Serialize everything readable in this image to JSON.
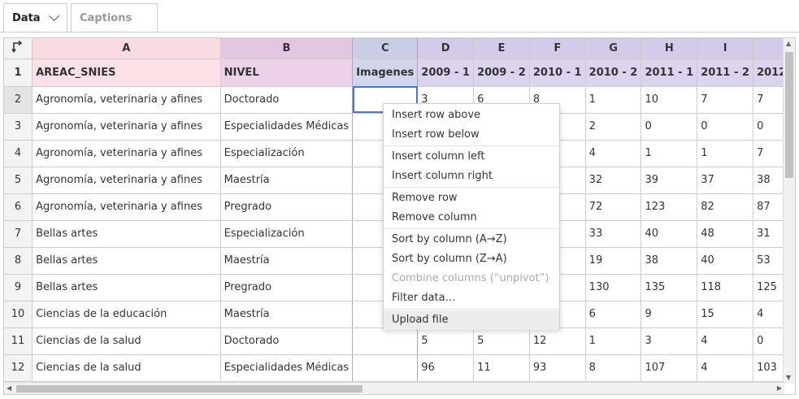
{
  "tabs": [
    {
      "label": "Data"
    },
    {
      "label": "Captions"
    }
  ],
  "columns": [
    "A",
    "B",
    "C",
    "D",
    "E",
    "F",
    "G",
    "H",
    "I",
    ""
  ],
  "corner_icon": "transpose-icon",
  "header_row": {
    "row_num": "1",
    "cells": [
      "AREAC_SNIES",
      "NIVEL",
      "Imagenes",
      "2009 - 1",
      "2009 - 2",
      "2010 - 1",
      "2010 - 2",
      "2011 - 1",
      "2011 - 2",
      "2012"
    ]
  },
  "rows": [
    {
      "row_num": "2",
      "cells": [
        "Agronomía, veterinaria y afines",
        "Doctorado",
        "",
        "3",
        "6",
        "8",
        "1",
        "10",
        "7",
        "7"
      ]
    },
    {
      "row_num": "3",
      "cells": [
        "Agronomía, veterinaria y afines",
        "Especialidades Médicas",
        "",
        "",
        "",
        "",
        "2",
        "0",
        "0",
        "0"
      ]
    },
    {
      "row_num": "4",
      "cells": [
        "Agronomía, veterinaria y afines",
        "Especialización",
        "",
        "",
        "",
        "",
        "4",
        "1",
        "1",
        "7"
      ]
    },
    {
      "row_num": "5",
      "cells": [
        "Agronomía, veterinaria y afines",
        "Maestría",
        "",
        "",
        "",
        "",
        "32",
        "39",
        "37",
        "38"
      ]
    },
    {
      "row_num": "6",
      "cells": [
        "Agronomía, veterinaria y afines",
        "Pregrado",
        "",
        "",
        "",
        "",
        "72",
        "123",
        "82",
        "87"
      ]
    },
    {
      "row_num": "7",
      "cells": [
        "Bellas artes",
        "Especialización",
        "",
        "",
        "",
        "",
        "33",
        "40",
        "48",
        "31"
      ]
    },
    {
      "row_num": "8",
      "cells": [
        "Bellas artes",
        "Maestría",
        "",
        "",
        "",
        "",
        "19",
        "38",
        "40",
        "53"
      ]
    },
    {
      "row_num": "9",
      "cells": [
        "Bellas artes",
        "Pregrado",
        "",
        "",
        "",
        "",
        "130",
        "135",
        "118",
        "125"
      ]
    },
    {
      "row_num": "10",
      "cells": [
        "Ciencias de la educación",
        "Maestría",
        "",
        "",
        "",
        "",
        "6",
        "9",
        "15",
        "4"
      ]
    },
    {
      "row_num": "11",
      "cells": [
        "Ciencias de la salud",
        "Doctorado",
        "",
        "5",
        "5",
        "12",
        "1",
        "3",
        "4",
        "0"
      ]
    },
    {
      "row_num": "12",
      "cells": [
        "Ciencias de la salud",
        "Especialidades Médicas",
        "",
        "96",
        "11",
        "93",
        "8",
        "107",
        "4",
        "103"
      ]
    }
  ],
  "context_menu": {
    "groups": [
      [
        {
          "label": "Insert row above",
          "disabled": false
        },
        {
          "label": "Insert row below",
          "disabled": false
        }
      ],
      [
        {
          "label": "Insert column left",
          "disabled": false
        },
        {
          "label": "Insert column right",
          "disabled": false
        }
      ],
      [
        {
          "label": "Remove row",
          "disabled": false
        },
        {
          "label": "Remove column",
          "disabled": false
        }
      ],
      [
        {
          "label": "Sort by column (A→Z)",
          "disabled": false
        },
        {
          "label": "Sort by column (Z→A)",
          "disabled": false
        },
        {
          "label": "Combine columns (“unpivot”)",
          "disabled": true
        },
        {
          "label": "Filter data…",
          "disabled": false
        }
      ],
      [
        {
          "label": "Upload file",
          "disabled": false,
          "highlighted": true
        }
      ]
    ]
  }
}
